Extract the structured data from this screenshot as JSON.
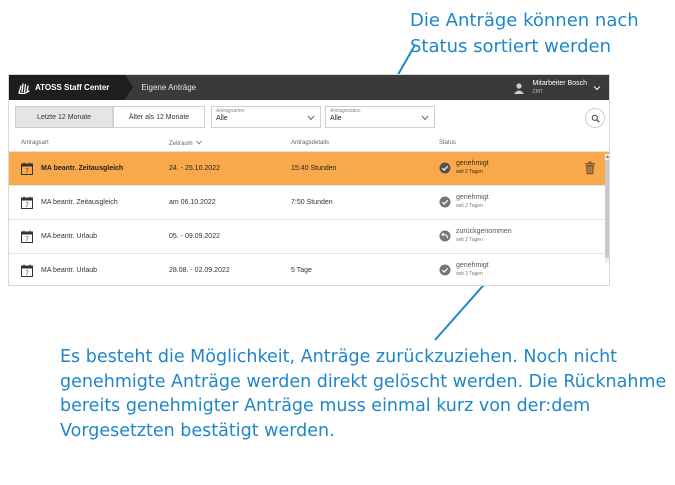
{
  "annotations": {
    "top": "Die Anträge können nach Status sortiert werden",
    "bottom": "Es besteht die Möglichkeit, Anträge zurückzuziehen. Noch nicht genehmigte Anträge werden direkt gelöscht werden. Die Rücknahme bereits genehmigter Anträge muss einmal kurz von der:dem Vorgesetzten bestätigt werden."
  },
  "app": {
    "brand": "ATOSS Staff Center",
    "page_tab": "Eigene Anträge",
    "user": {
      "name": "Mitarbeiter Bosch",
      "sub": "ZMT"
    }
  },
  "filters": {
    "range_last": "Letzte 12 Monate",
    "range_older": "Älter als 12 Monate",
    "types": {
      "label": "Antragsarten",
      "value": "Alle"
    },
    "status": {
      "label": "Antragsstatus",
      "value": "Alle"
    }
  },
  "table": {
    "headers": {
      "type": "Antragsart",
      "period": "Zeitraum",
      "details": "Antragsdetails",
      "status": "Status"
    },
    "rows": [
      {
        "type": "MA beantr. Zeitausgleich",
        "period": "24. - 25.10.2022",
        "details": "15:40 Stunden",
        "status": "genehmigt",
        "status_sub": "seit 2 Tagen",
        "status_kind": "check-circle-icon",
        "highlighted": true
      },
      {
        "type": "MA beantr. Zeitausgleich",
        "period": "am 06.10.2022",
        "details": "7:50 Stunden",
        "status": "genehmigt",
        "status_sub": "seit 2 Tagen",
        "status_kind": "check-circle-icon",
        "highlighted": false
      },
      {
        "type": "MA beantr. Urlaub",
        "period": "05. - 09.09.2022",
        "details": "",
        "status": "zurückgenommen",
        "status_sub": "seit 2 Tagen",
        "status_kind": "undo-circle-icon",
        "highlighted": false
      },
      {
        "type": "MA beantr. Urlaub",
        "period": "28.08. - 02.09.2022",
        "details": "5 Tage",
        "status": "genehmigt",
        "status_sub": "seit 2 Tagen",
        "status_kind": "check-circle-icon",
        "highlighted": false
      }
    ]
  },
  "colors": {
    "annotation": "#1f86c8",
    "highlight_row": "#f9a94b",
    "topbar": "#3a3a3a"
  }
}
